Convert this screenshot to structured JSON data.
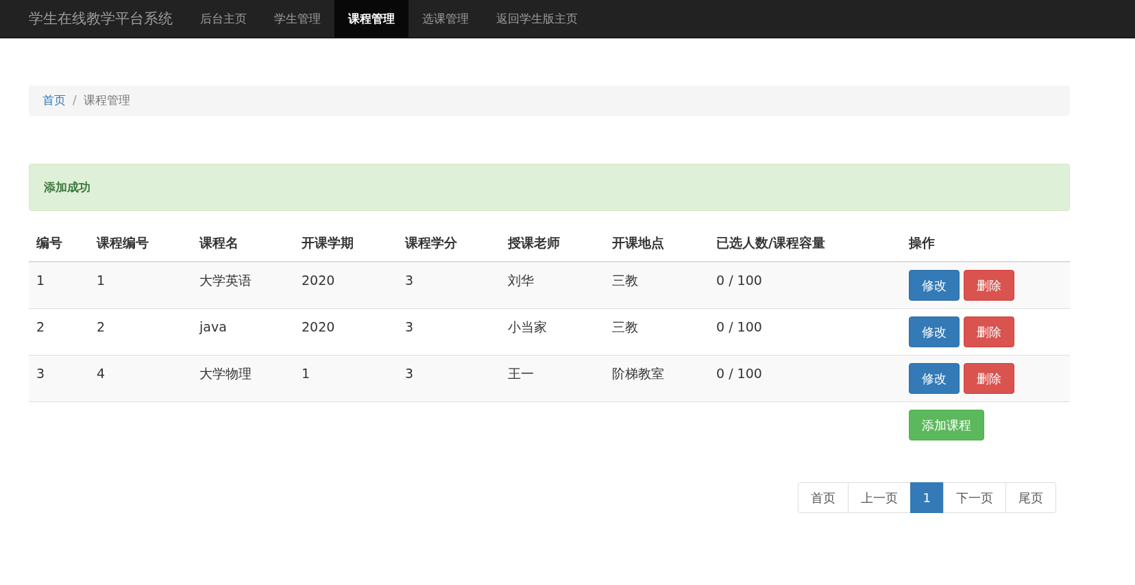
{
  "navbar": {
    "brand": "学生在线教学平台系统",
    "items": [
      {
        "label": "后台主页",
        "selected": false
      },
      {
        "label": "学生管理",
        "selected": false
      },
      {
        "label": "课程管理",
        "selected": true
      },
      {
        "label": "选课管理",
        "selected": false
      },
      {
        "label": "返回学生版主页",
        "selected": false
      }
    ]
  },
  "breadcrumb": [
    {
      "label": "首页",
      "kind": "link"
    },
    {
      "label": "/",
      "kind": "separator"
    },
    {
      "label": "课程管理",
      "kind": "current"
    }
  ],
  "alert": {
    "text": "添加成功"
  },
  "table": {
    "columns": [
      "编号",
      "课程编号",
      "课程名",
      "开课学期",
      "课程学分",
      "授课老师",
      "开课地点",
      "已选人数/课程容量",
      "操作"
    ],
    "rows": [
      {
        "cells": [
          "1",
          "1",
          "大学英语",
          "2020",
          "3",
          "刘华",
          "三教",
          "0 / 100"
        ],
        "actions": [
          "修改",
          "删除"
        ]
      },
      {
        "cells": [
          "2",
          "2",
          "java",
          "2020",
          "3",
          "小当家",
          "三教",
          "0 / 100"
        ],
        "actions": [
          "修改",
          "删除"
        ]
      },
      {
        "cells": [
          "3",
          "4",
          "大学物理",
          "1",
          "3",
          "王一",
          "阶梯教室",
          "0 / 100"
        ],
        "actions": [
          "修改",
          "删除"
        ]
      }
    ]
  },
  "add_button": "添加课程",
  "pagination": [
    {
      "label": "首页",
      "selected": false
    },
    {
      "label": "上一页",
      "selected": false
    },
    {
      "label": "1",
      "selected": true
    },
    {
      "label": "下一页",
      "selected": false
    },
    {
      "label": "尾页",
      "selected": false
    }
  ]
}
